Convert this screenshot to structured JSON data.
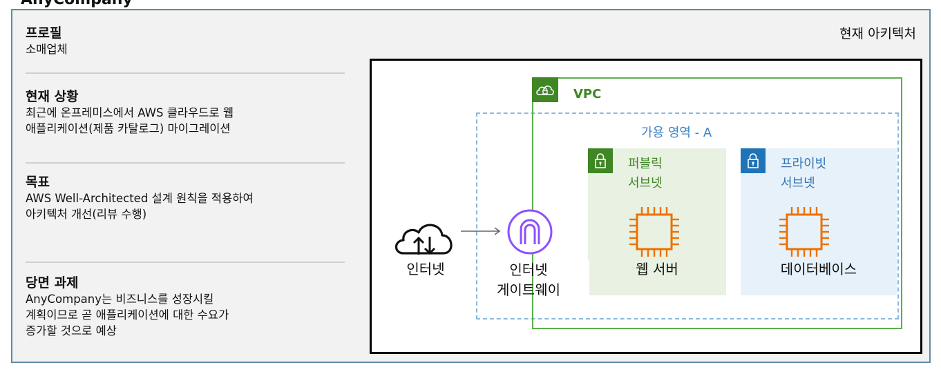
{
  "partial_title": "AnyCompany",
  "left": {
    "profile": {
      "title": "프로필",
      "body": "소매업체"
    },
    "situation": {
      "title": "현재 상황",
      "body": "최근에 온프레미스에서 AWS 클라우드로 웹\n애플리케이션(제품 카탈로그) 마이그레이션"
    },
    "goal": {
      "title": "목표",
      "body": "AWS Well-Architected 설계 원칙을 적용하여\n아키텍처 개선(리뷰 수행)"
    },
    "challenge": {
      "title": "당면 과제",
      "body": "AnyCompany는 비즈니스를 성장시킬\n계획이므로 곧 애플리케이션에 대한 수요가\n증가할 것으로 예상"
    }
  },
  "architecture": {
    "title": "현재 아키텍처",
    "vpc_label": "VPC",
    "az_label": "가용 영역 - A",
    "public_subnet": "퍼블릭\n서브넷",
    "private_subnet": "프라이빗\n서브넷",
    "internet": "인터넷",
    "igw": "인터넷\n게이트웨이",
    "web_server": "웹 서버",
    "database": "데이터베이스"
  },
  "colors": {
    "panel_border": "#5f8ca3",
    "vpc_green": "#3f8624",
    "private_blue": "#1f73b7",
    "igw_purple": "#8c4fff",
    "ec2_orange": "#ed7100"
  },
  "icons": [
    "cloud-icon",
    "lock-icon",
    "internet-icon",
    "internet-gateway-icon",
    "chip-icon"
  ]
}
